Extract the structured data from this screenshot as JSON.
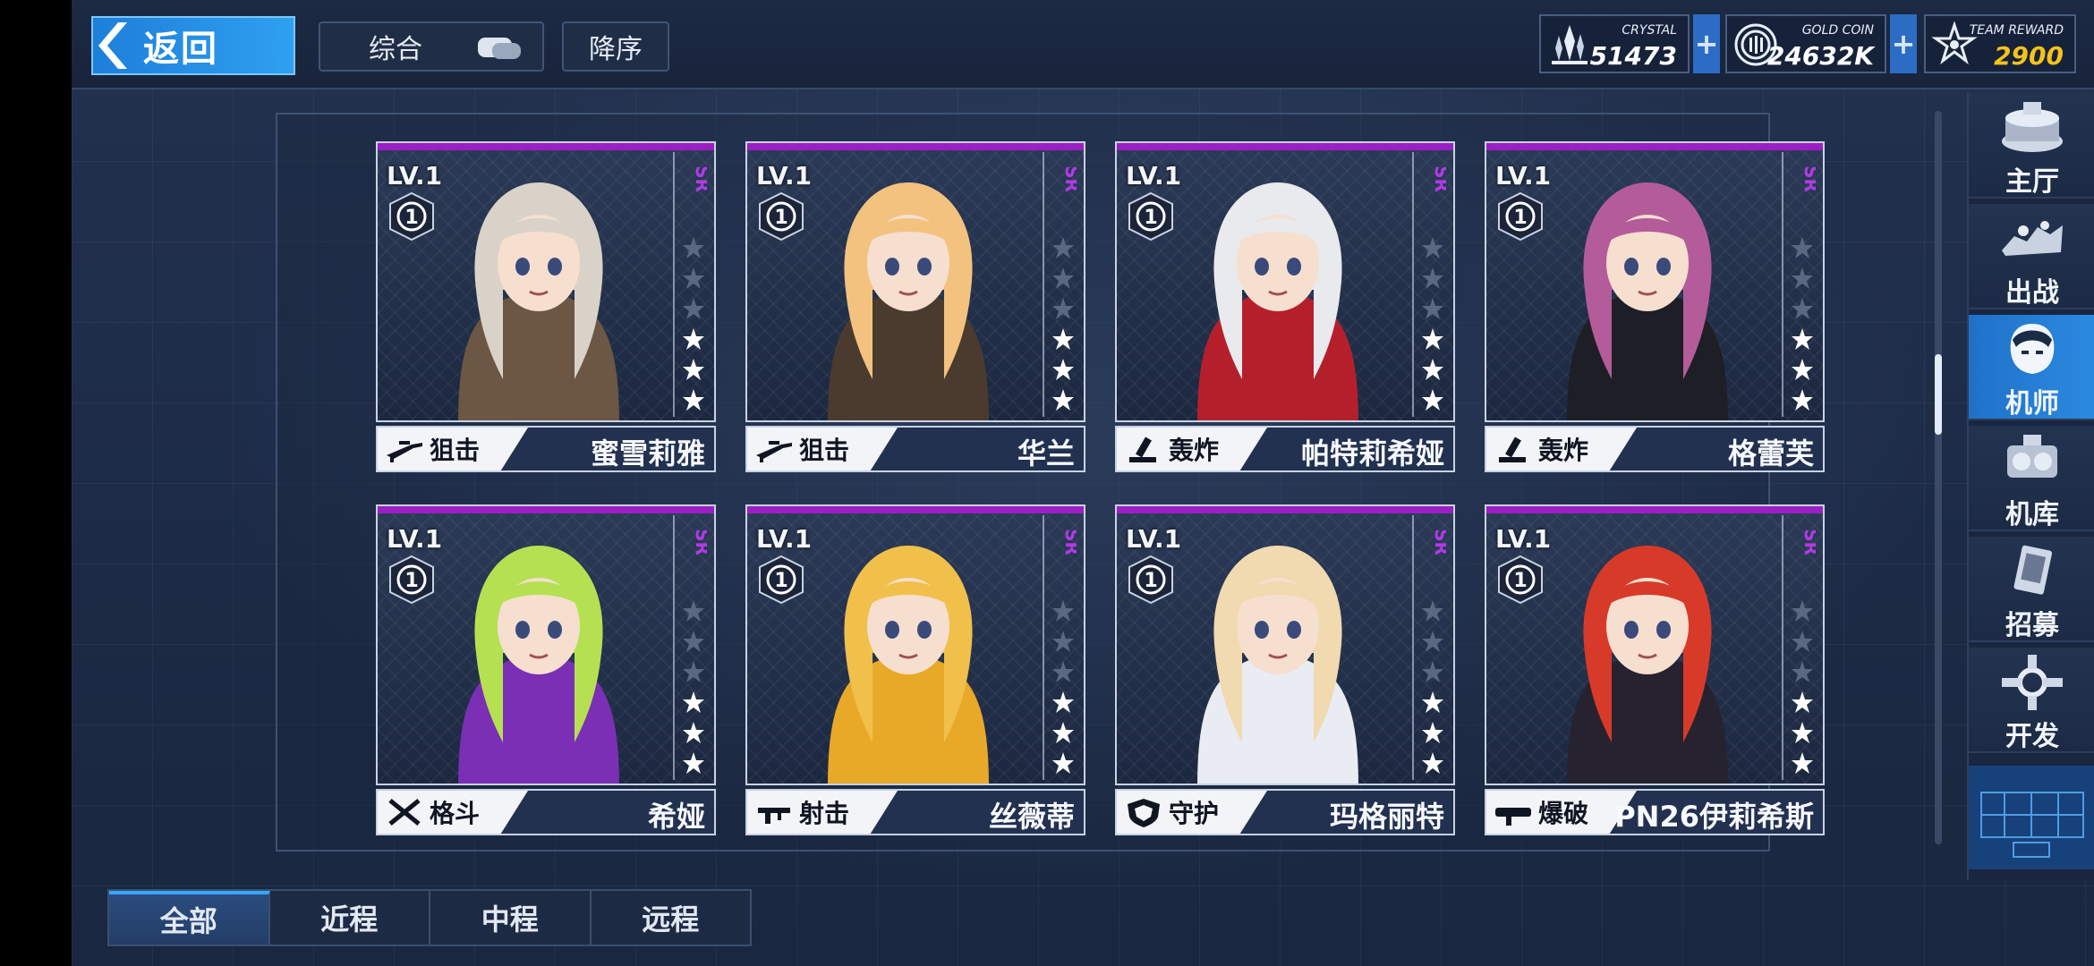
{
  "header": {
    "back_label": "返回",
    "sort_label": "综合",
    "order_label": "降序",
    "currencies": [
      {
        "name": "CRYSTAL",
        "value": "51473",
        "icon": "crystal-icon",
        "color": "#ffffff"
      },
      {
        "name": "GOLD COIN",
        "value": "24632K",
        "icon": "gold-coin-icon",
        "color": "#ffffff"
      },
      {
        "name": "TEAM REWARD",
        "value": "2900",
        "icon": "team-reward-icon",
        "color": "#f5c21b"
      }
    ],
    "plus_label": "+"
  },
  "cards": [
    {
      "level": "LV.1",
      "badge": "1",
      "rarity": "SR",
      "stars_filled": 3,
      "stars_total": 6,
      "role": "狙击",
      "role_icon": "sniper-rifle-icon",
      "name": "蜜雪莉雅",
      "hair": "#d9d2c8",
      "outfit": "#6b5744"
    },
    {
      "level": "LV.1",
      "badge": "1",
      "rarity": "SR",
      "stars_filled": 3,
      "stars_total": 6,
      "role": "狙击",
      "role_icon": "sniper-rifle-icon",
      "name": "华兰",
      "hair": "#f3c27f",
      "outfit": "#4b3b2e"
    },
    {
      "level": "LV.1",
      "badge": "1",
      "rarity": "SR",
      "stars_filled": 3,
      "stars_total": 6,
      "role": "轰炸",
      "role_icon": "mortar-icon",
      "name": "帕特莉希娅",
      "hair": "#e8eaee",
      "outfit": "#b51f2c"
    },
    {
      "level": "LV.1",
      "badge": "1",
      "rarity": "SR",
      "stars_filled": 3,
      "stars_total": 6,
      "role": "轰炸",
      "role_icon": "mortar-icon",
      "name": "格蕾芙",
      "hair": "#b45c9a",
      "outfit": "#1e1e26"
    },
    {
      "level": "LV.1",
      "badge": "1",
      "rarity": "SR",
      "stars_filled": 3,
      "stars_total": 6,
      "role": "格斗",
      "role_icon": "crossed-swords-icon",
      "name": "希娅",
      "hair": "#b5e052",
      "outfit": "#7a2fb5"
    },
    {
      "level": "LV.1",
      "badge": "1",
      "rarity": "SR",
      "stars_filled": 3,
      "stars_total": 6,
      "role": "射击",
      "role_icon": "rifle-icon",
      "name": "丝薇蒂",
      "hair": "#f0c04a",
      "outfit": "#e9a928"
    },
    {
      "level": "LV.1",
      "badge": "1",
      "rarity": "SR",
      "stars_filled": 3,
      "stars_total": 6,
      "role": "守护",
      "role_icon": "shield-icon",
      "name": "玛格丽特",
      "hair": "#f1d9b0",
      "outfit": "#e9ecf2"
    },
    {
      "level": "LV.1",
      "badge": "1",
      "rarity": "SR",
      "stars_filled": 3,
      "stars_total": 6,
      "role": "爆破",
      "role_icon": "rocket-launcher-icon",
      "name": "PN26伊莉希斯",
      "hair": "#d83a2a",
      "outfit": "#262230"
    }
  ],
  "sidebar": {
    "items": [
      {
        "label": "主厅",
        "icon": "main-hall-icon",
        "active": false
      },
      {
        "label": "出战",
        "icon": "sortie-icon",
        "active": false
      },
      {
        "label": "机师",
        "icon": "pilot-icon",
        "active": true
      },
      {
        "label": "机库",
        "icon": "hangar-icon",
        "active": false
      },
      {
        "label": "招募",
        "icon": "recruit-icon",
        "active": false
      },
      {
        "label": "开发",
        "icon": "develop-icon",
        "active": false
      }
    ]
  },
  "tabs": [
    {
      "label": "全部",
      "active": true
    },
    {
      "label": "近程",
      "active": false
    },
    {
      "label": "中程",
      "active": false
    },
    {
      "label": "远程",
      "active": false
    }
  ],
  "colors": {
    "accent": "#2b8ae0",
    "rarity_sr": "#b13be6",
    "team_reward": "#f5c21b"
  }
}
